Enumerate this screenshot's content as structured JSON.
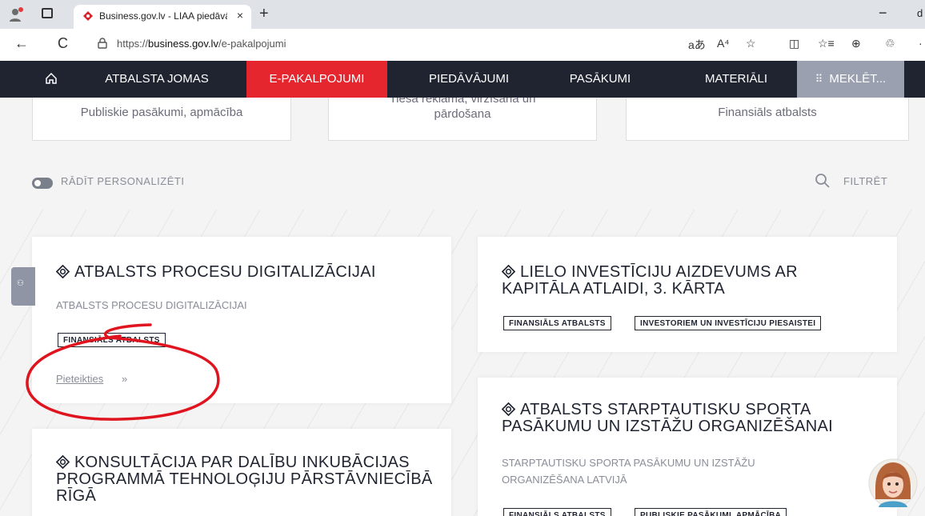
{
  "browser": {
    "tab_title": "Business.gov.lv - LIAA piedāvātie",
    "tab_close": "×",
    "new_tab": "+",
    "minimize": "−",
    "clipped": "d",
    "back": "←",
    "reload": "C",
    "url_prefix": "https://",
    "url_domain": "business.gov.lv",
    "url_path": "/e-pakalpojumi",
    "tools": [
      "aあ",
      "A⁴",
      "☆",
      "◫",
      "☆≡",
      "⊕",
      "♲",
      "·"
    ]
  },
  "nav": {
    "home_icon": "home-icon",
    "items": [
      "ATBALSTA JOMAS",
      "E-PAKALPOJUMI",
      "PIEDĀVĀJUMI",
      "PASĀKUMI",
      "MATERIĀLI"
    ],
    "search_label": "MEKLĒT..."
  },
  "top_cards": {
    "left": "Publiskie pasākumi, apmācība",
    "middle_line1": "Tiešā reklāma, virzīšana un",
    "middle_line2": "pārdošana",
    "right": "Finansiāls atbalsts"
  },
  "controls": {
    "personalize_label": "RĀDĪT PERSONALIZĒTI",
    "filter_label": "FILTRĒT"
  },
  "cards": {
    "digital": {
      "title": "ATBALSTS PROCESU DIGITALIZĀCIJAI",
      "desc": "ATBALSTS PROCESU DIGITALIZĀCIJAI",
      "tag": "FINANSIĀLS ATBALSTS",
      "apply": "Pieteikties",
      "apply_arrow": "»"
    },
    "invest": {
      "title_line1": "LIELO INVESTĪCIJU AIZDEVUMS AR",
      "title_line2": "KAPITĀLA ATLAIDI, 3. KĀRTA",
      "tag1": "FINANSIĀLS ATBALSTS",
      "tag2": "INVESTORIEM UN INVESTĪCIJU PIESAISTEI"
    },
    "sport": {
      "title_line1": "ATBALSTS STARPTAUTISKU SPORTA",
      "title_line2": "PASĀKUMU UN IZSTĀŽU ORGANIZĒŠANAI",
      "desc_line1": "STARPTAUTISKU SPORTA PASĀKUMU UN IZSTĀŽU",
      "desc_line2": "ORGANIZĒŠANA LATVIJĀ",
      "tag1": "FINANSIĀLS ATBALSTS",
      "tag2": "PUBLISKIE PASĀKUMI, APMĀCĪBA"
    },
    "consult": {
      "title_line1": "KONSULTĀCIJA PAR DALĪBU INKUBĀCIJAS",
      "title_line2": "PROGRAMMĀ TEHNOLOĢIJU PĀRSTĀVNIECĪBĀ",
      "title_line3": "RĪGĀ"
    }
  },
  "sidebar_tab_icon": "accessibility-icon",
  "colors": {
    "nav_bg": "#1f2430",
    "accent": "#e6262e",
    "annotation": "#e0141e"
  }
}
